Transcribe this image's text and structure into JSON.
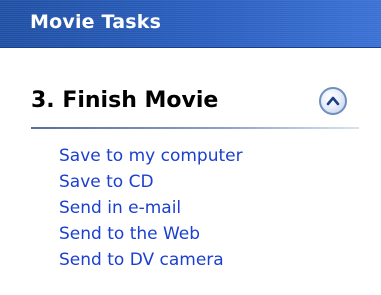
{
  "pane": {
    "title": "Movie Tasks"
  },
  "section": {
    "title": "3. Finish Movie",
    "collapse_icon": "chevron-up-icon",
    "expanded": true
  },
  "tasks": [
    {
      "label": "Save to my computer"
    },
    {
      "label": "Save to CD"
    },
    {
      "label": "Send in e-mail"
    },
    {
      "label": "Send to the Web"
    },
    {
      "label": "Send to DV camera"
    }
  ],
  "colors": {
    "header_background": "#2a5fc0",
    "header_text": "#ffffff",
    "link": "#1b3fd1",
    "section_title": "#000000",
    "divider": "#5a6f96"
  }
}
